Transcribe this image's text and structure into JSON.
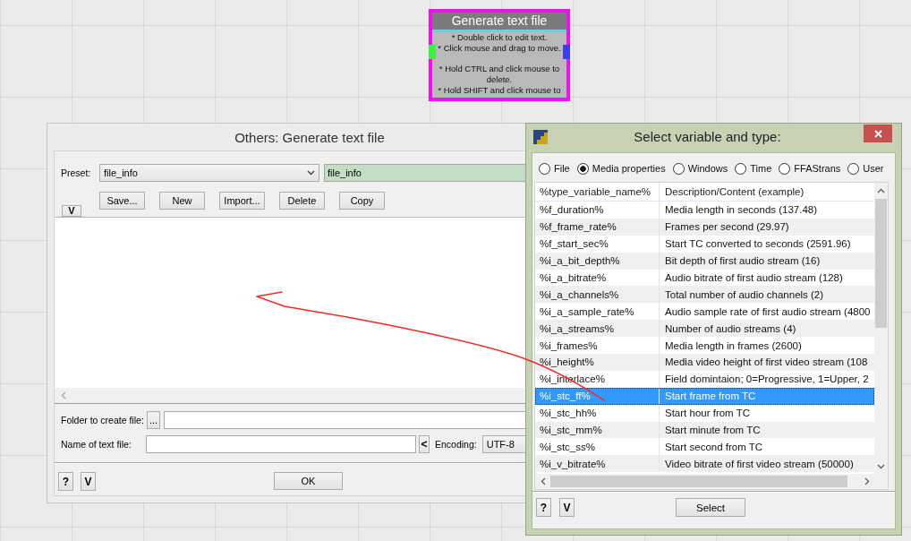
{
  "node": {
    "title": "Generate text file",
    "note_groups": [
      [
        "* Double click to edit text.",
        "* Click mouse and drag to move."
      ],
      [
        "* Hold CTRL and click mouse to delete.",
        "* Hold SHIFT and click mouse to"
      ]
    ]
  },
  "editor_window": {
    "title": "Others: Generate text file",
    "preset_label": "Preset:",
    "preset_value": "file_info",
    "preset_name": "file_info",
    "collapse_button": "V",
    "preset_buttons": [
      "Save...",
      "New",
      "Import...",
      "Delete",
      "Copy"
    ],
    "folder_label": "Folder to create file:",
    "browse_button": "...",
    "name_label": "Name of text file:",
    "insert_button": "<",
    "encoding_label": "Encoding:",
    "encoding_value": "UTF-8",
    "help_button": "?",
    "toggle_button": "V",
    "ok_button": "OK"
  },
  "variable_window": {
    "title": "Select variable and type:",
    "categories": [
      {
        "label": "File",
        "selected": false
      },
      {
        "label": "Media properties",
        "selected": true
      },
      {
        "label": "Windows",
        "selected": false
      },
      {
        "label": "Time",
        "selected": false
      },
      {
        "label": "FFAStrans",
        "selected": false
      },
      {
        "label": "User",
        "selected": false
      }
    ],
    "columns": [
      "%type_variable_name%",
      "Description/Content (example)"
    ],
    "rows": [
      {
        "name": "%f_duration%",
        "description": "Media length in seconds (137.48)",
        "selected": false
      },
      {
        "name": "%f_frame_rate%",
        "description": "Frames per second (29.97)",
        "selected": false
      },
      {
        "name": "%f_start_sec%",
        "description": "Start TC converted to seconds (2591.96)",
        "selected": false
      },
      {
        "name": "%i_a_bit_depth%",
        "description": "Bit depth of first audio stream (16)",
        "selected": false
      },
      {
        "name": "%i_a_bitrate%",
        "description": "Audio bitrate of first audio stream (128)",
        "selected": false
      },
      {
        "name": "%i_a_channels%",
        "description": "Total number of audio channels (2)",
        "selected": false
      },
      {
        "name": "%i_a_sample_rate%",
        "description": "Audio sample rate of first audio stream (4800",
        "selected": false
      },
      {
        "name": "%i_a_streams%",
        "description": "Number of audio streams (4)",
        "selected": false
      },
      {
        "name": "%i_frames%",
        "description": "Media length in frames (2600)",
        "selected": false
      },
      {
        "name": "%i_height%",
        "description": "Media video height of first video stream (108",
        "selected": false
      },
      {
        "name": "%i_interlace%",
        "description": "Field domintaion; 0=Progressive, 1=Upper, 2",
        "selected": false
      },
      {
        "name": "%i_stc_ff%",
        "description": "Start frame from TC",
        "selected": true
      },
      {
        "name": "%i_stc_hh%",
        "description": "Start hour from TC",
        "selected": false
      },
      {
        "name": "%i_stc_mm%",
        "description": "Start minute from TC",
        "selected": false
      },
      {
        "name": "%i_stc_ss%",
        "description": "Start second from TC",
        "selected": false
      },
      {
        "name": "%i_v_bitrate%",
        "description": "Video bitrate of first video stream (50000)",
        "selected": false
      }
    ],
    "help_button": "?",
    "toggle_button": "V",
    "select_button": "Select"
  }
}
